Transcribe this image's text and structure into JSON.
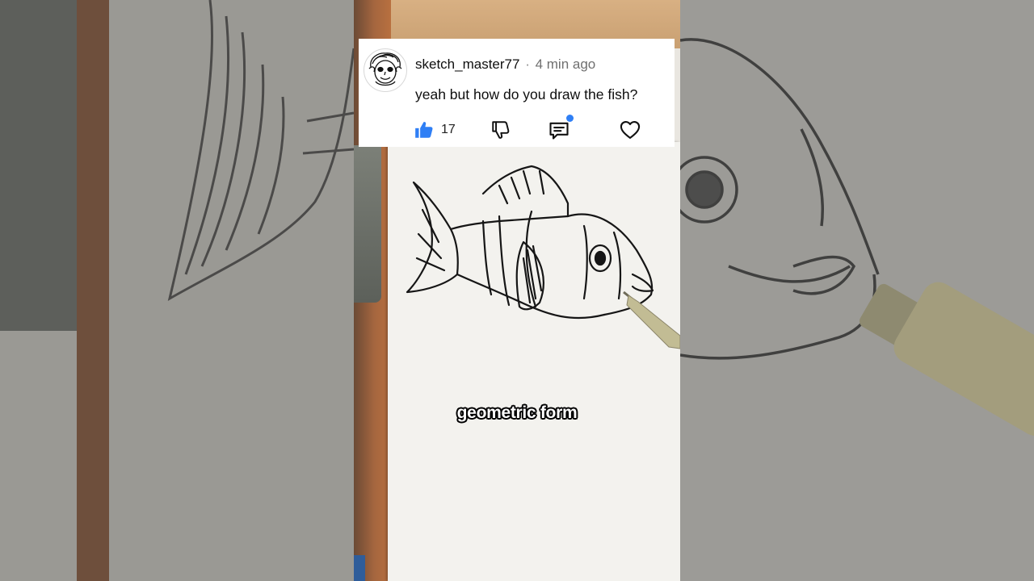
{
  "comment": {
    "username": "sketch_master77",
    "separator": "·",
    "time": "4 min ago",
    "text": "yeah but how do you draw the fish?",
    "like_count": "17"
  },
  "caption": "geometric form",
  "icons": {
    "avatar": "sketched-face-avatar",
    "like": "thumbs-up-icon",
    "dislike": "thumbs-down-icon",
    "reply": "comment-bubble-icon",
    "heart": "heart-icon"
  },
  "colors": {
    "like_active": "#2f7ff5",
    "notification_dot": "#2f7ff5",
    "card_background": "#ffffff",
    "caption_text": "#ffffff"
  }
}
